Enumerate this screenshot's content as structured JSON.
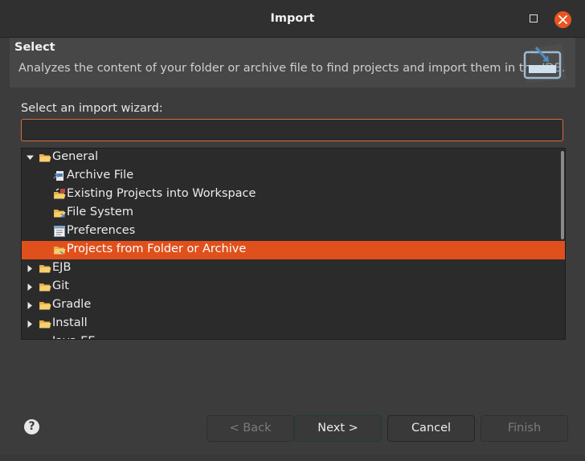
{
  "window": {
    "title": "Import"
  },
  "header": {
    "section_title": "Select",
    "description": "Analyzes the content of your folder or archive file to find projects and import them in the IDE."
  },
  "wizard": {
    "label": "Select an import wizard:",
    "filter_value": "",
    "tree": [
      {
        "label": "General",
        "level": 0,
        "expanded": true,
        "icon": "folder-open-icon"
      },
      {
        "label": "Archive File",
        "level": 1,
        "icon": "archive-file-icon"
      },
      {
        "label": "Existing Projects into Workspace",
        "level": 1,
        "icon": "existing-projects-icon"
      },
      {
        "label": "File System",
        "level": 1,
        "icon": "file-system-icon"
      },
      {
        "label": "Preferences",
        "level": 1,
        "icon": "preferences-icon"
      },
      {
        "label": "Projects from Folder or Archive",
        "level": 1,
        "icon": "projects-folder-icon",
        "selected": true
      },
      {
        "label": "EJB",
        "level": 0,
        "expanded": false,
        "icon": "folder-open-icon"
      },
      {
        "label": "Git",
        "level": 0,
        "expanded": false,
        "icon": "folder-open-icon"
      },
      {
        "label": "Gradle",
        "level": 0,
        "expanded": false,
        "icon": "folder-open-icon"
      },
      {
        "label": "Install",
        "level": 0,
        "expanded": false,
        "icon": "folder-open-icon"
      },
      {
        "label": "Java EE",
        "level": 0,
        "expanded": false,
        "icon": "folder-open-icon"
      }
    ]
  },
  "buttons": {
    "help": "?",
    "back": "< Back",
    "next": "Next >",
    "cancel": "Cancel",
    "finish": "Finish"
  },
  "colors": {
    "accent": "#e0501c",
    "close_button": "#e95420",
    "background": "#3c3c3c"
  }
}
